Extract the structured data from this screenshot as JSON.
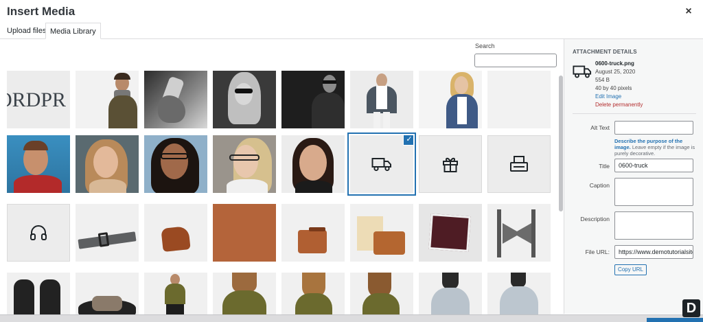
{
  "title": "Insert Media",
  "close": "×",
  "tabs": [
    {
      "label": "Upload files"
    },
    {
      "label": "Media Library"
    }
  ],
  "search": {
    "label": "Search",
    "value": ""
  },
  "grid_items": [
    {
      "kind": "logo",
      "text": "ORDPR"
    },
    {
      "kind": "photo",
      "desc": "man in scarf"
    },
    {
      "kind": "photo",
      "desc": "hand with phone"
    },
    {
      "kind": "photo",
      "desc": "woman sunglasses"
    },
    {
      "kind": "photo",
      "desc": "man in suit"
    },
    {
      "kind": "photo",
      "desc": "man in jacket"
    },
    {
      "kind": "photo",
      "desc": "woman denim jacket"
    },
    {
      "kind": "blank"
    },
    {
      "kind": "photo",
      "desc": "smiling man"
    },
    {
      "kind": "photo",
      "desc": "smiling woman"
    },
    {
      "kind": "photo",
      "desc": "woman glasses"
    },
    {
      "kind": "photo",
      "desc": "woman glasses blonde"
    },
    {
      "kind": "photo",
      "desc": "woman dark hair"
    },
    {
      "kind": "icon",
      "icon": "truck-icon",
      "selected": true
    },
    {
      "kind": "icon",
      "icon": "gift-icon"
    },
    {
      "kind": "icon",
      "icon": "payment-icon"
    },
    {
      "kind": "icon",
      "icon": "headphones-icon"
    },
    {
      "kind": "photo",
      "desc": "belt"
    },
    {
      "kind": "photo",
      "desc": "leather pouch"
    },
    {
      "kind": "photo",
      "desc": "leather bag"
    },
    {
      "kind": "photo",
      "desc": "leather wallet"
    },
    {
      "kind": "photo",
      "desc": "wallet box"
    },
    {
      "kind": "photo",
      "desc": "pocket square"
    },
    {
      "kind": "photo",
      "desc": "bow tie"
    },
    {
      "kind": "photo",
      "desc": "gloves"
    },
    {
      "kind": "photo",
      "desc": "belt buckle"
    },
    {
      "kind": "photo",
      "desc": "woman green top"
    },
    {
      "kind": "photo",
      "desc": "woman green tee"
    },
    {
      "kind": "photo",
      "desc": "woman green tee 2"
    },
    {
      "kind": "photo",
      "desc": "woman green tee 3"
    },
    {
      "kind": "photo",
      "desc": "person grey hoodie"
    },
    {
      "kind": "photo",
      "desc": "person grey tee"
    }
  ],
  "details": {
    "heading": "ATTACHMENT DETAILS",
    "filename": "0600-truck.png",
    "date": "August 25, 2020",
    "size": "554 B",
    "dimensions": "40 by 40 pixels",
    "edit_link": "Edit Image",
    "delete_link": "Delete permanently",
    "alt_text_label": "Alt Text",
    "alt_text_value": "",
    "help_link": "Describe the purpose of the image.",
    "help_text": " Leave empty if the image is purely decorative.",
    "title_label": "Title",
    "title_value": "0600-truck",
    "caption_label": "Caption",
    "description_label": "Description",
    "file_url_label": "File URL:",
    "file_url_value": "https://www.demotutorialsite.com",
    "copy_url_label": "Copy URL"
  },
  "brand_letter": "D",
  "colors": {
    "accent": "#2271b1",
    "danger": "#b32d2e"
  }
}
